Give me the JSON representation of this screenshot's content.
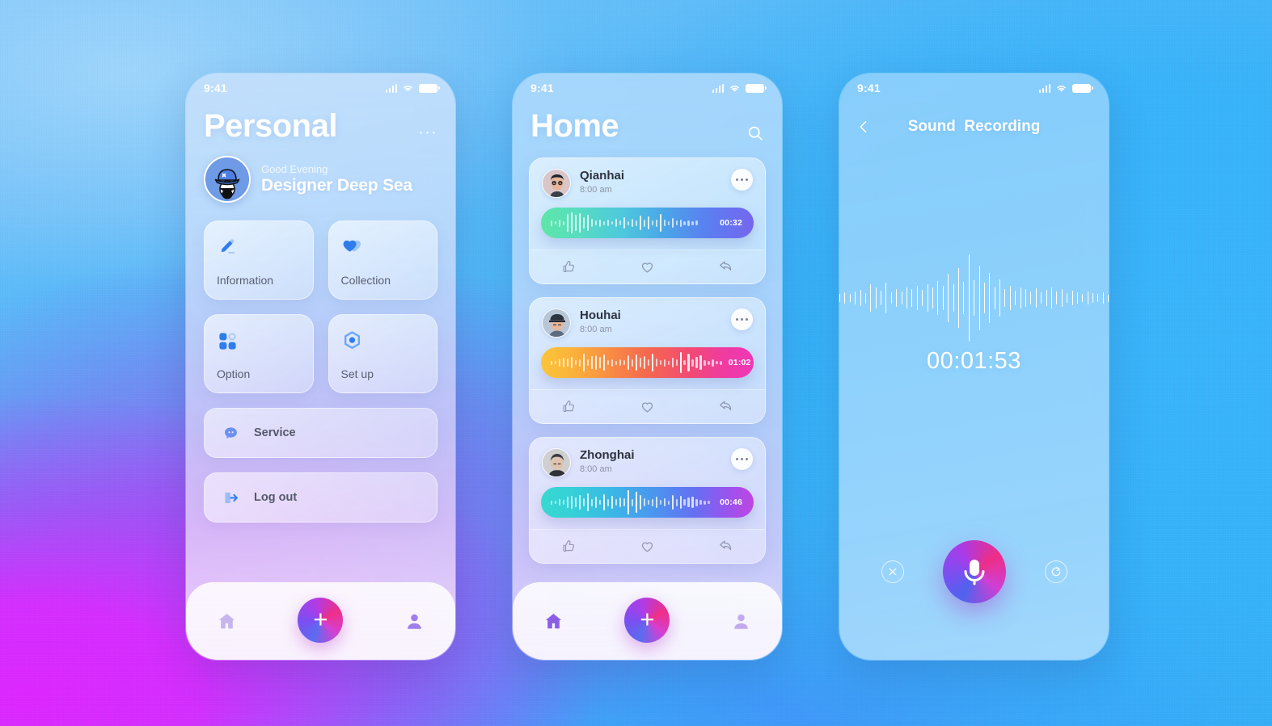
{
  "statusbar": {
    "time": "9:41",
    "icons": [
      "signal-icon",
      "wifi-icon",
      "battery-icon"
    ]
  },
  "personal": {
    "title": "Personal",
    "menu_icon": "···",
    "profile": {
      "avatar_icon": "avatar-bucket-hat",
      "greeting": "Good Evening",
      "name": "Designer Deep Sea"
    },
    "tiles": [
      {
        "label": "Information",
        "icon": "pencil-icon"
      },
      {
        "label": "Collection",
        "icon": "heart-tag-icon"
      },
      {
        "label": "Option",
        "icon": "grid-dots-icon"
      },
      {
        "label": "Set up",
        "icon": "gear-hex-icon"
      }
    ],
    "rows": [
      {
        "label": "Service",
        "icon": "chat-bubble-icon"
      },
      {
        "label": "Log out",
        "icon": "logout-arrow-icon"
      }
    ],
    "tabbar": {
      "home_label": "home-icon",
      "add_label": "+",
      "profile_label": "person-icon",
      "active": "profile"
    }
  },
  "home": {
    "title": "Home",
    "search_icon": "search-icon",
    "cards": [
      {
        "name": "Qianhai",
        "time": "8:00 am",
        "duration": "00:32",
        "more_icon": "more-dots-icon",
        "avatar_icon": "avatar-man-glasses",
        "gradient": "linear-gradient(90deg,#5ee6a8 0%,#57dcc0 18%,#4ec8dd 38%,#4aa6e8 58%,#5a7ff0 78%,#7566ef 100%)",
        "actions": [
          "thumbs-up-icon",
          "heart-icon",
          "reply-icon"
        ],
        "wave": [
          7,
          4,
          9,
          5,
          22,
          26,
          20,
          24,
          14,
          20,
          10,
          6,
          9,
          5,
          8,
          4,
          10,
          6,
          14,
          5,
          10,
          7,
          18,
          9,
          16,
          6,
          9,
          22,
          8,
          5,
          12,
          6,
          9,
          5,
          7,
          5,
          6
        ]
      },
      {
        "name": "Houhai",
        "time": "8:00 am",
        "duration": "01:02",
        "more_icon": "more-dots-icon",
        "avatar_icon": "avatar-person-cap",
        "gradient": "linear-gradient(90deg,#fbc53a 0%,#fbb03b 16%,#f98d44 32%,#f5684f 50%,#f24a74 70%,#ef3ba1 86%,#ee38b8 100%)",
        "actions": [
          "thumbs-up-icon",
          "heart-icon",
          "reply-icon"
        ],
        "wave": [
          5,
          4,
          9,
          12,
          10,
          14,
          6,
          9,
          22,
          8,
          16,
          18,
          14,
          20,
          6,
          9,
          5,
          8,
          6,
          18,
          9,
          20,
          12,
          16,
          8,
          22,
          10,
          6,
          9,
          5,
          12,
          8,
          26,
          6,
          22,
          9,
          14,
          18,
          7,
          5,
          9,
          4,
          5
        ]
      },
      {
        "name": "Zhonghai",
        "time": "8:00 am",
        "duration": "00:46",
        "more_icon": "more-dots-icon",
        "avatar_icon": "avatar-person-dark",
        "gradient": "linear-gradient(90deg,#37d9d0 0%,#36cfd8 16%,#3bb6e6 34%,#4c94ef 54%,#6470f2 72%,#9b53ed 88%,#bf45e2 100%)",
        "actions": [
          "thumbs-up-icon",
          "heart-icon",
          "reply-icon"
        ],
        "wave": [
          5,
          4,
          8,
          6,
          14,
          16,
          12,
          18,
          10,
          22,
          9,
          14,
          6,
          20,
          9,
          16,
          8,
          12,
          10,
          30,
          9,
          26,
          18,
          10,
          6,
          9,
          14,
          6,
          10,
          5,
          18,
          9,
          16,
          8,
          12,
          14,
          9,
          6,
          5,
          4
        ]
      }
    ],
    "tabbar": {
      "home_label": "home-icon",
      "add_label": "+",
      "profile_label": "person-icon",
      "active": "home"
    }
  },
  "recording": {
    "back_icon": "chevron-left-icon",
    "title": "Sound  Recording",
    "timer": "00:01:53",
    "wave": [
      10,
      14,
      10,
      16,
      20,
      13,
      34,
      26,
      18,
      38,
      14,
      22,
      16,
      26,
      22,
      30,
      20,
      34,
      26,
      42,
      30,
      60,
      34,
      74,
      40,
      108,
      44,
      80,
      38,
      62,
      28,
      46,
      22,
      30,
      18,
      26,
      22,
      16,
      24,
      14,
      20,
      26,
      16,
      22,
      12,
      18,
      14,
      10,
      16,
      12,
      10,
      14,
      9
    ],
    "controls": {
      "cancel_icon": "close-icon",
      "record_icon": "microphone-icon",
      "redo_icon": "redo-icon"
    }
  },
  "colors": {
    "accent_start": "#5b6cf0",
    "accent_mid": "#b03ce8",
    "accent_end": "#ef2f87",
    "icon_blue": "#2f7ded",
    "text_dark": "#2f3340",
    "text_muted": "#8e93a4"
  }
}
